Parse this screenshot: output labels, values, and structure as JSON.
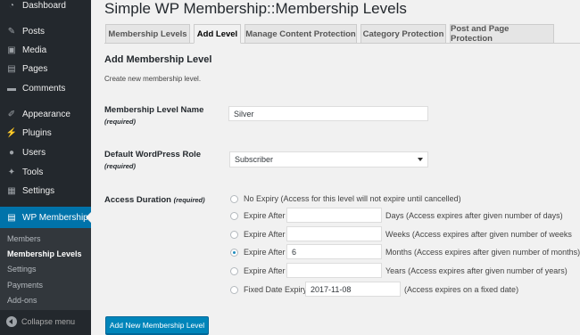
{
  "sidebar": {
    "dashboard": "Dashboard",
    "posts": "Posts",
    "media": "Media",
    "pages": "Pages",
    "comments": "Comments",
    "appearance": "Appearance",
    "plugins": "Plugins",
    "users": "Users",
    "tools": "Tools",
    "settings": "Settings",
    "wp_membership": "WP Membership",
    "submenu": [
      "Members",
      "Membership Levels",
      "Settings",
      "Payments",
      "Add-ons"
    ],
    "collapse": "Collapse menu"
  },
  "page_title": "Simple WP Membership::Membership Levels",
  "tabs": [
    "Membership Levels",
    "Add Level",
    "Manage Content Protection",
    "Category Protection",
    "Post and Page Protection"
  ],
  "form": {
    "heading": "Add Membership Level",
    "description": "Create new membership level.",
    "level_name_label": "Membership Level Name",
    "required": "(required)",
    "level_name_value": "Silver",
    "role_label": "Default WordPress Role",
    "role_value": "Subscriber",
    "duration_label": "Access Duration",
    "duration_required": "(required)",
    "options": {
      "no_expiry": "No Expiry (Access for this level will not expire until cancelled)",
      "expire_after": "Expire After",
      "days": "Days (Access expires after given number of days)",
      "weeks": "Weeks (Access expires after given number of weeks",
      "months": "Months (Access expires after given number of months)",
      "years": "Years (Access expires after given number of years)",
      "fixed_date": "Fixed Date Expiry",
      "fixed_date_note": "(Access expires on a fixed date)"
    },
    "months_value": "6",
    "fixed_date_value": "2017-11-08",
    "submit": "Add New Membership Level"
  },
  "colors": {
    "sidebar_bg": "#23282d",
    "accent": "#0073aa",
    "button": "#0085ba"
  }
}
